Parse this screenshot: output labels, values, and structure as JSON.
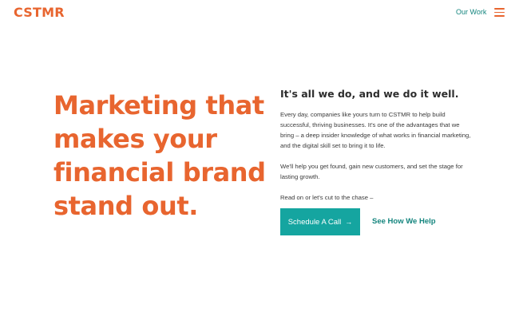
{
  "header": {
    "logo_text": "CSTMR",
    "nav_link": "Our Work",
    "menu_icon": "hamburger-menu-icon"
  },
  "hero": {
    "title": "Marketing that makes your financial brand stand out.",
    "subheading": "It's all we do, and we do it well.",
    "paragraphs": [
      "Every day, companies like yours turn to CSTMR to help build successful, thriving businesses. It's one of the advantages that we bring – a deep insider knowledge of what works in financial marketing, and the digital skill set to bring it to life.",
      "We'll help you get found, gain new customers, and set the stage for lasting growth.",
      "Read on or let's cut to the chase –"
    ],
    "primary_cta": {
      "label": "Schedule A Call",
      "icon": "→"
    },
    "secondary_cta": "See How We Help"
  },
  "colors": {
    "brand_orange": "#e8652f",
    "teal_button": "#15a5a0",
    "teal_text": "#14857e",
    "body_text": "#3a3a3a"
  }
}
